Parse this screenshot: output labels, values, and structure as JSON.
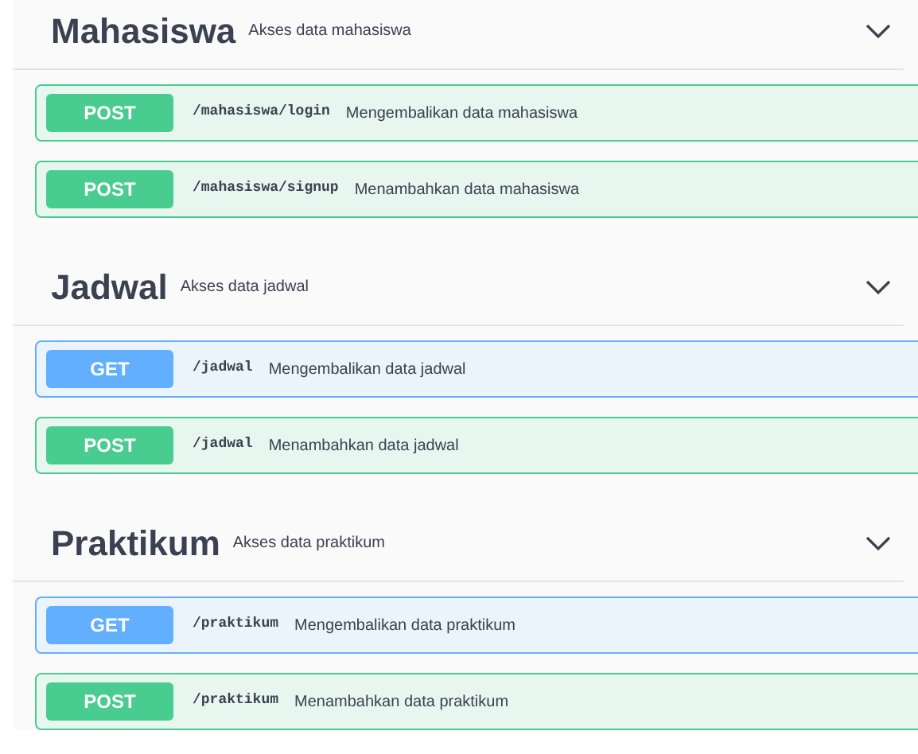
{
  "tags": [
    {
      "name": "Mahasiswa",
      "description": "Akses data mahasiswa",
      "expanded": true,
      "operations": [
        {
          "method": "POST",
          "path": "/mahasiswa/login",
          "summary": "Mengembalikan data mahasiswa"
        },
        {
          "method": "POST",
          "path": "/mahasiswa/signup",
          "summary": "Menambahkan data mahasiswa"
        }
      ]
    },
    {
      "name": "Jadwal",
      "description": "Akses data jadwal",
      "expanded": true,
      "operations": [
        {
          "method": "GET",
          "path": "/jadwal",
          "summary": "Mengembalikan data jadwal"
        },
        {
          "method": "POST",
          "path": "/jadwal",
          "summary": "Menambahkan data jadwal"
        }
      ]
    },
    {
      "name": "Praktikum",
      "description": "Akses data praktikum",
      "expanded": true,
      "operations": [
        {
          "method": "GET",
          "path": "/praktikum",
          "summary": "Mengembalikan data praktikum"
        },
        {
          "method": "POST",
          "path": "/praktikum",
          "summary": "Menambahkan data praktikum"
        }
      ]
    }
  ]
}
